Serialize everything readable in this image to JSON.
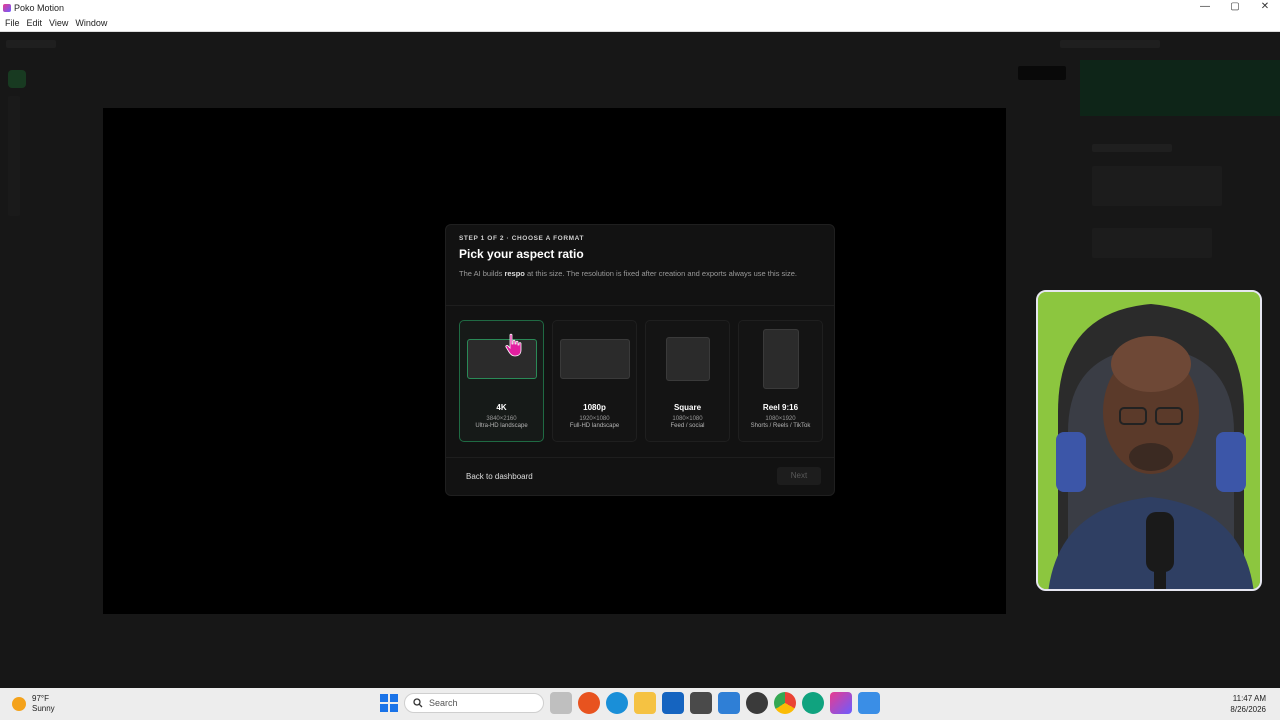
{
  "window": {
    "title": "Poko Motion",
    "controls": [
      "—",
      "▢",
      "✕"
    ]
  },
  "menu": [
    "File",
    "Edit",
    "View",
    "Window"
  ],
  "modal": {
    "step": "STEP 1 OF 2 · CHOOSE A FORMAT",
    "title": "Pick your aspect ratio",
    "desc_prefix": "The AI builds ",
    "desc_bold": "respo",
    "desc_suffix": " at this size. The resolution is fixed after creation and exports always use this size.",
    "options": [
      {
        "name": "4K",
        "resolution": "3840×2160",
        "subtitle": "Ultra-HD landscape",
        "selected": true
      },
      {
        "name": "1080p",
        "resolution": "1920×1080",
        "subtitle": "Full-HD landscape",
        "selected": false
      },
      {
        "name": "Square",
        "resolution": "1080×1080",
        "subtitle": "Feed / social",
        "selected": false
      },
      {
        "name": "Reel 9:16",
        "resolution": "1080×1920",
        "subtitle": "Shorts / Reels / TikTok",
        "selected": false
      }
    ],
    "back_label": "Back to dashboard",
    "next_label": "Next"
  },
  "taskbar": {
    "weather_temp": "97°F",
    "weather_desc": "Sunny",
    "search_placeholder": "Search",
    "time": "11:47 AM",
    "date": "8/26/2026"
  },
  "colors": {
    "accent": "#2a8a57",
    "cursor": "#e21fa0",
    "modal_bg": "#121212"
  }
}
